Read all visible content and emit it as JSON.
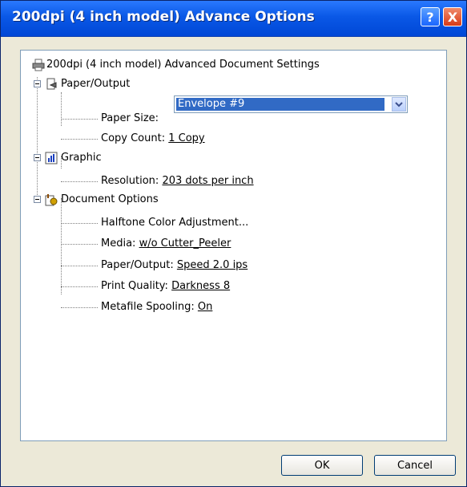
{
  "window": {
    "title": "200dpi (4 inch model) Advance Options",
    "help_label": "?",
    "close_label": "X"
  },
  "tree": {
    "root_label": "200dpi (4 inch model) Advanced Document Settings",
    "paper_output": {
      "label": "Paper/Output",
      "paper_size": {
        "label": "Paper Size:",
        "value": "Envelope #9"
      },
      "copy_count": {
        "label": "Copy Count:",
        "value": "1 Copy"
      }
    },
    "graphic": {
      "label": "Graphic",
      "resolution": {
        "label": "Resolution:",
        "value": "203 dots per inch"
      }
    },
    "document_options": {
      "label": "Document Options",
      "halftone": {
        "label": "Halftone Color Adjustment..."
      },
      "media": {
        "label": "Media:",
        "value": "w/o Cutter_Peeler"
      },
      "paper_output": {
        "label": "Paper/Output:",
        "value": "Speed 2.0 ips"
      },
      "print_quality": {
        "label": "Print Quality:",
        "value": "Darkness 8"
      },
      "metafile": {
        "label": "Metafile Spooling:",
        "value": "On"
      }
    }
  },
  "buttons": {
    "ok": "OK",
    "cancel": "Cancel"
  },
  "icons": {
    "printer": "printer-icon",
    "paper_output": "paper-output-icon",
    "graphic": "graphic-chart-icon",
    "document_options": "document-options-icon",
    "dropdown_arrow": "chevron-down-icon"
  },
  "colors": {
    "title_bar": "#0a58e6",
    "selection": "#316ac5",
    "dialog_bg": "#ece9d8"
  }
}
